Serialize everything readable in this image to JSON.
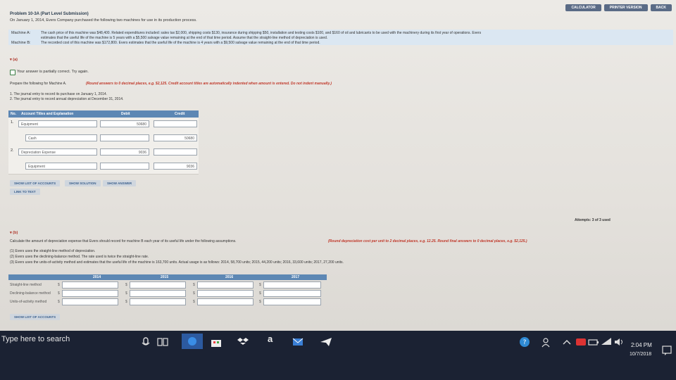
{
  "toolbar": {
    "calculator": "CALCULATOR",
    "printer": "PRINTER VERSION",
    "back": "BACK"
  },
  "problem": {
    "title": "Problem 10-3A (Part Level Submission)",
    "intro": "On January 1, 2014, Evers Company purchased the following two machines for use in its production process.",
    "machine_a_label": "Machine A:",
    "machine_a_text1": "The cash price of this machine was $48,400. Related expenditures included: sales tax $2,000, shipping costs $130, insurance during shipping $50, installation and testing costs $100, and $160 of oil and lubricants to be used with the machinery during its first year of operations. Evers",
    "machine_a_text2": "estimates that the useful life of the machine is 5 years with a $5,500 salvage value remaining at the end of that time period. Assume that the straight-line method of depreciation is used.",
    "machine_b_label": "Machine B:",
    "machine_b_text": "The recorded cost of this machine was $172,800. Evers estimates that the useful life of the machine is 4 years with a $9,500 salvage value remaining at the end of that time period."
  },
  "part_a": {
    "toggle": "▾ (a)",
    "status": "Your answer is partially correct.  Try again.",
    "prompt": "Prepare the following for Machine A.",
    "instruction": "(Round answers to 0 decimal places, e.g. $2,125. Credit account titles are automatically indented when amount is entered. Do not indent manually.)",
    "item1": "1.  The journal entry to record its purchase on January 1, 2014.",
    "item2": "2.  The journal entry to record annual depreciation at December 31, 2014.",
    "table_head": {
      "no": "No.",
      "account": "Account Titles and Explanation",
      "debit": "Debit",
      "credit": "Credit"
    },
    "entries": [
      {
        "no": "1.",
        "account": "Equipment",
        "debit": "50680",
        "credit": ""
      },
      {
        "no": "",
        "account": "Cash",
        "debit": "",
        "credit": "50680"
      },
      {
        "no": "2.",
        "account": "Depreciation Expense",
        "debit": "9036",
        "credit": ""
      },
      {
        "no": "",
        "account": "Equipment",
        "debit": "",
        "credit": "9036"
      }
    ],
    "btn_accounts": "SHOW LIST OF ACCOUNTS",
    "btn_solution": "SHOW SOLUTION",
    "btn_answer": "SHOW ANSWER",
    "link_text": "LINK TO TEXT",
    "attempts": "Attempts: 3 of 3 used"
  },
  "part_b": {
    "toggle": "▾ (b)",
    "prompt": "Calculate the amount of depreciation expense that Evers should record for machine B each year of its useful life under the following assumptions.",
    "instruction": "(Round depreciation cost per unit to 2 decimal places, e.g. 12.25. Round final answers to 0 decimal places, e.g. $2,125.)",
    "a1": "(1)   Evers uses the straight-line method of depreciation.",
    "a2": "(2)   Evers uses the declining-balance method. The rate used is twice the straight-line rate.",
    "a3": "(3)   Evers uses the units-of-activity method and estimates that the useful life of the machine is 163,700 units. Actual usage is as follows: 2014, 58,700 units; 2015, 44,200 units; 2016, 33,600 units; 2017, 27,200 units.",
    "years": [
      "2014",
      "2015",
      "2016",
      "2017"
    ],
    "rows": [
      "Straight-line method",
      "Declining-balance method",
      "Units-of-activity method"
    ],
    "dollar": "$",
    "btn_accounts": "SHOW LIST OF ACCOUNTS"
  },
  "taskbar": {
    "search": "Type here to search",
    "time": "2:04 PM",
    "date": "10/7/2018",
    "app_letter": "a"
  },
  "colors": {
    "accent": "#5d87b4",
    "error": "#c0392b",
    "taskbar": "#1b2233"
  }
}
